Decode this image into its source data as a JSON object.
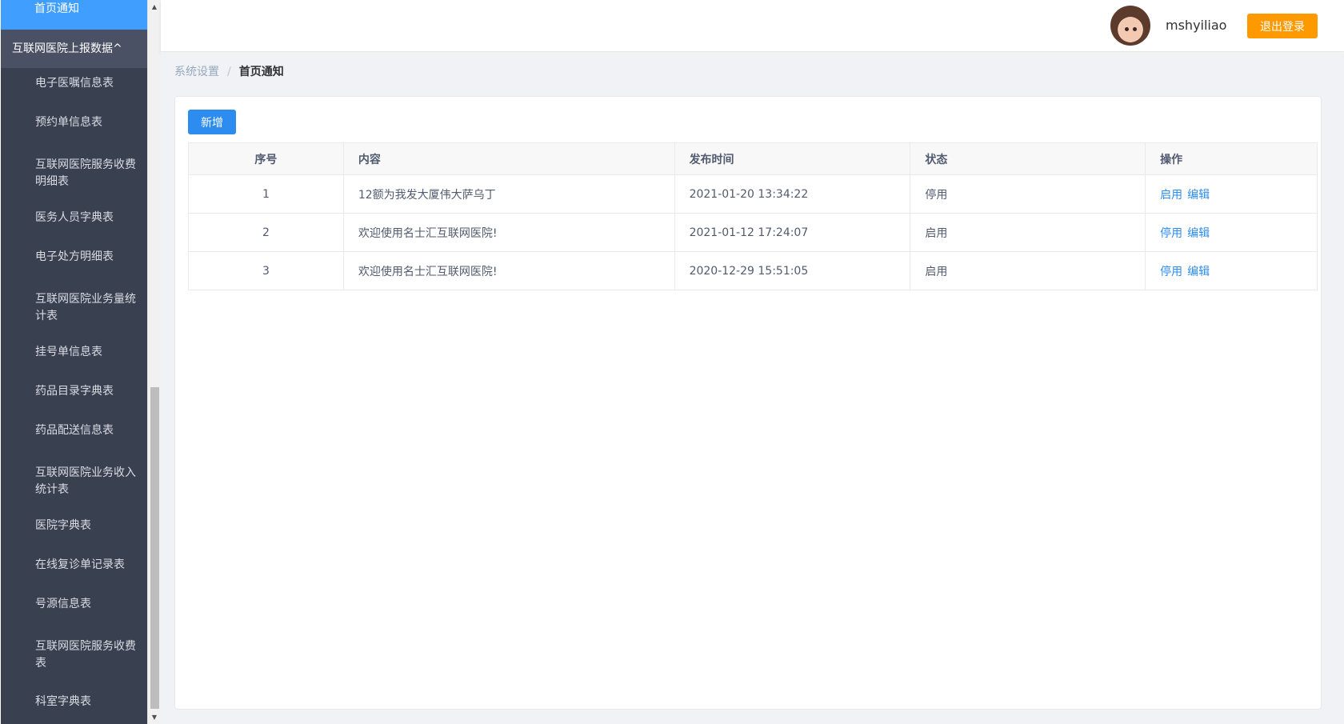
{
  "sidebar": {
    "active_item": "首页通知",
    "group_label": "互联网医院上报数据",
    "group_caret": "^",
    "items": [
      {
        "label": "电子医嘱信息表"
      },
      {
        "label": "预约单信息表"
      },
      {
        "label": "互联网医院服务收费明细表"
      },
      {
        "label": "医务人员字典表"
      },
      {
        "label": "电子处方明细表"
      },
      {
        "label": "互联网医院业务量统计表"
      },
      {
        "label": "挂号单信息表"
      },
      {
        "label": "药品目录字典表"
      },
      {
        "label": "药品配送信息表"
      },
      {
        "label": "互联网医院业务收入统计表"
      },
      {
        "label": "医院字典表"
      },
      {
        "label": "在线复诊单记录表"
      },
      {
        "label": "号源信息表"
      },
      {
        "label": "互联网医院服务收费表"
      },
      {
        "label": "科室字典表"
      }
    ]
  },
  "header": {
    "username": "mshyiliao",
    "logout_label": "退出登录"
  },
  "breadcrumb": {
    "parent": "系统设置",
    "separator": "/",
    "current": "首页通知"
  },
  "toolbar": {
    "add_label": "新增"
  },
  "table": {
    "columns": [
      "序号",
      "内容",
      "发布时间",
      "状态",
      "操作"
    ],
    "rows": [
      {
        "index": "1",
        "content": "12额为我发大厦伟大萨乌丁",
        "time": "2021-01-20 13:34:22",
        "status": "停用",
        "toggle_action": "启用",
        "edit_action": "编辑"
      },
      {
        "index": "2",
        "content": "欢迎使用名士汇互联网医院!",
        "time": "2021-01-12 17:24:07",
        "status": "启用",
        "toggle_action": "停用",
        "edit_action": "编辑"
      },
      {
        "index": "3",
        "content": "欢迎使用名士汇互联网医院!",
        "time": "2020-12-29 15:51:05",
        "status": "启用",
        "toggle_action": "停用",
        "edit_action": "编辑"
      }
    ]
  },
  "colors": {
    "sidebar_bg": "#394050",
    "sidebar_active": "#409eff",
    "primary": "#2d8cf0",
    "logout": "#ff9900"
  }
}
